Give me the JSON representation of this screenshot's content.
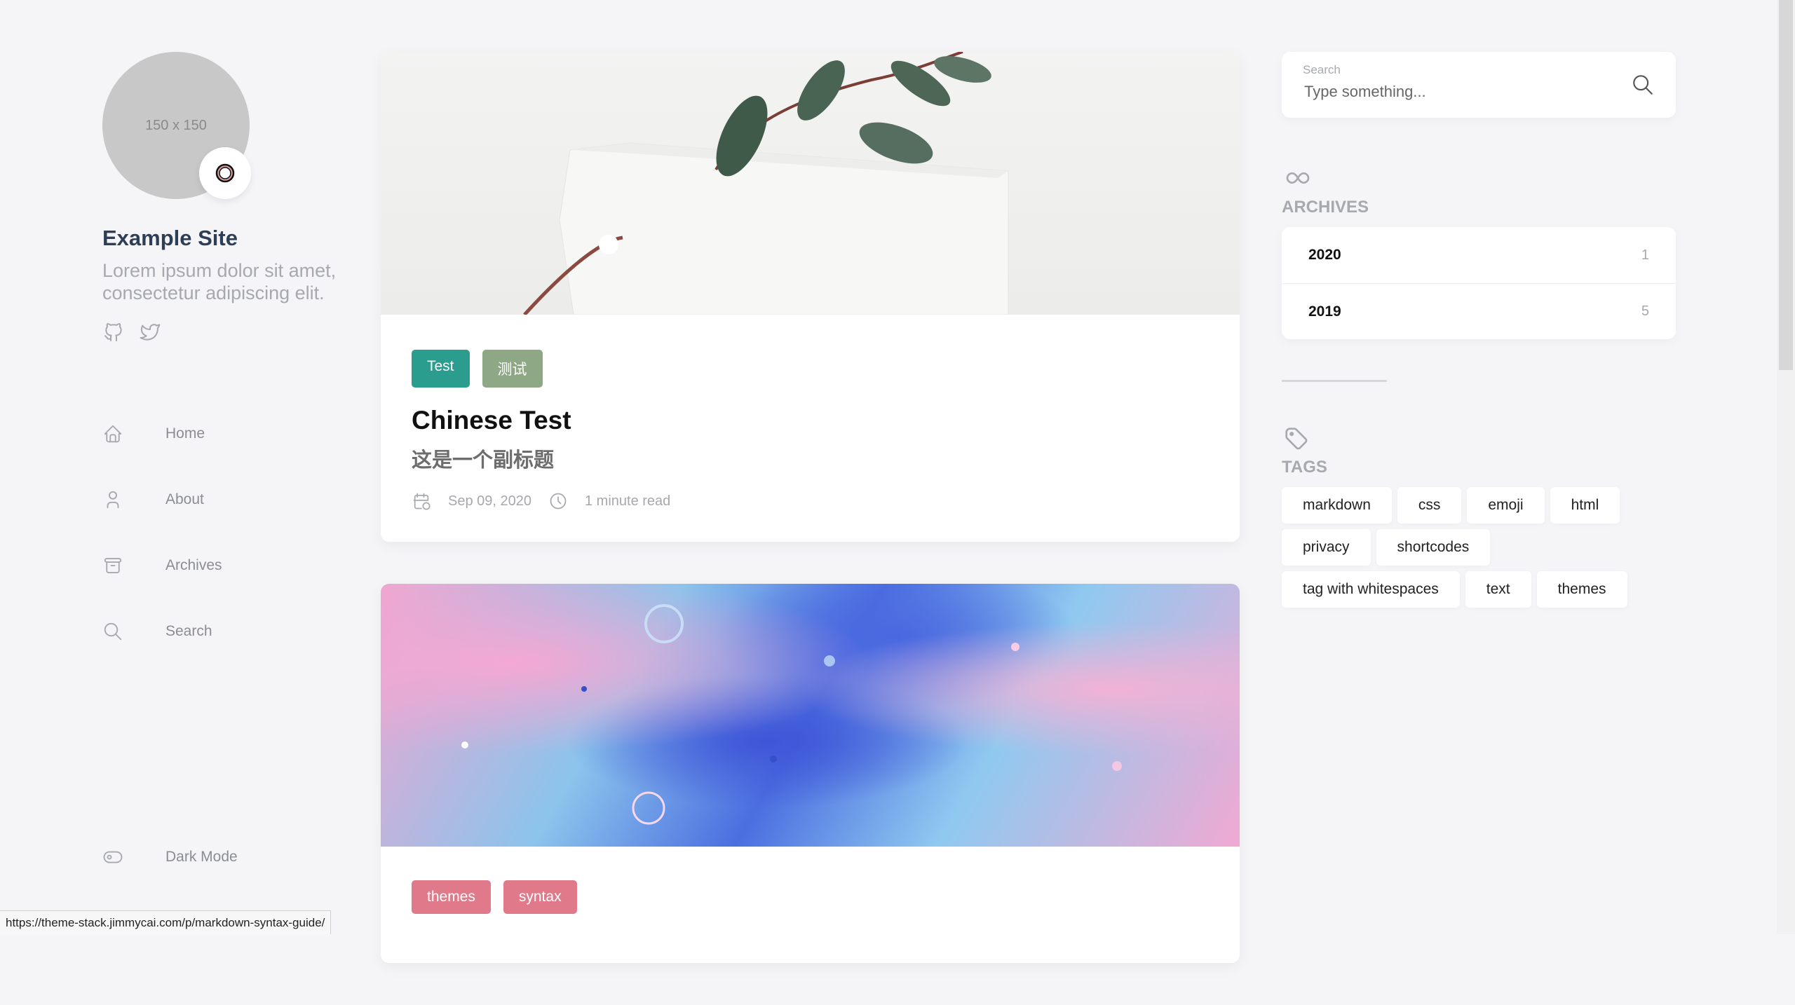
{
  "site": {
    "avatar_placeholder": "150 x 150",
    "emoji": "face-emoji",
    "name": "Example Site",
    "description": "Lorem ipsum dolor sit amet, consectetur adipiscing elit."
  },
  "social": [
    "github-icon",
    "twitter-icon"
  ],
  "menu": {
    "home": "Home",
    "about": "About",
    "archives": "Archives",
    "search": "Search",
    "dark_mode": "Dark Mode"
  },
  "posts": [
    {
      "image": "leaf-and-paper-tag",
      "tags": [
        {
          "label": "Test",
          "color": "#2a9d8f"
        },
        {
          "label": "测试",
          "color": "#8ea885"
        }
      ],
      "title": "Chinese Test",
      "subtitle": "这是一个副标题",
      "date": "Sep 09, 2020",
      "read_time": "1 minute read"
    },
    {
      "image": "pink-blue-fluid-paint",
      "tags": [
        {
          "label": "themes",
          "color": "#e07a8a"
        },
        {
          "label": "syntax",
          "color": "#e07a8a"
        }
      ]
    }
  ],
  "search": {
    "label": "Search",
    "placeholder": "Type something..."
  },
  "archives": {
    "title": "ARCHIVES",
    "items": [
      {
        "year": "2020",
        "count": "1"
      },
      {
        "year": "2019",
        "count": "5"
      }
    ]
  },
  "tags_widget": {
    "title": "TAGS",
    "items": [
      "markdown",
      "css",
      "emoji",
      "html",
      "privacy",
      "shortcodes",
      "tag with whitespaces",
      "text",
      "themes"
    ]
  },
  "status_url": "https://theme-stack.jimmycai.com/p/markdown-syntax-guide/"
}
